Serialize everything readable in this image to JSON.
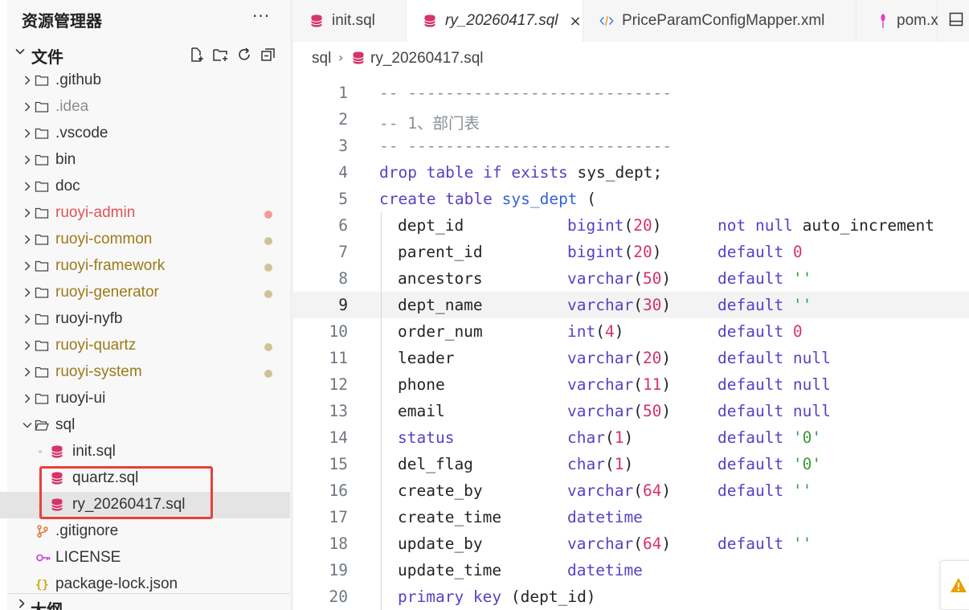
{
  "sidebar": {
    "title": "资源管理器",
    "more": "···",
    "files_section": {
      "title": "文件"
    },
    "outline_section": {
      "title": "大纲"
    },
    "tree": [
      {
        "label": ".github",
        "type": "folder",
        "depth": 0,
        "color": "#333333",
        "status": ""
      },
      {
        "label": ".idea",
        "type": "folder",
        "depth": 0,
        "color": "#8c8c8c",
        "status": ""
      },
      {
        "label": ".vscode",
        "type": "folder",
        "depth": 0,
        "color": "#333333",
        "status": ""
      },
      {
        "label": "bin",
        "type": "folder",
        "depth": 0,
        "color": "#333333",
        "status": ""
      },
      {
        "label": "doc",
        "type": "folder",
        "depth": 0,
        "color": "#333333",
        "status": ""
      },
      {
        "label": "ruoyi-admin",
        "type": "folder",
        "depth": 0,
        "color": "#e05252",
        "status": "error"
      },
      {
        "label": "ruoyi-common",
        "type": "folder",
        "depth": 0,
        "color": "#9c7a1a",
        "status": "modified"
      },
      {
        "label": "ruoyi-framework",
        "type": "folder",
        "depth": 0,
        "color": "#9c7a1a",
        "status": "modified"
      },
      {
        "label": "ruoyi-generator",
        "type": "folder",
        "depth": 0,
        "color": "#9c7a1a",
        "status": "modified"
      },
      {
        "label": "ruoyi-nyfb",
        "type": "folder",
        "depth": 0,
        "color": "#333333",
        "status": ""
      },
      {
        "label": "ruoyi-quartz",
        "type": "folder",
        "depth": 0,
        "color": "#9c7a1a",
        "status": "modified"
      },
      {
        "label": "ruoyi-system",
        "type": "folder",
        "depth": 0,
        "color": "#9c7a1a",
        "status": "modified"
      },
      {
        "label": "ruoyi-ui",
        "type": "folder",
        "depth": 0,
        "color": "#333333",
        "status": ""
      },
      {
        "label": "sql",
        "type": "folder-open",
        "depth": 0,
        "color": "#333333",
        "status": ""
      },
      {
        "label": "init.sql",
        "type": "sql",
        "depth": 1,
        "color": "#333333",
        "status": ""
      },
      {
        "label": "quartz.sql",
        "type": "sql",
        "depth": 1,
        "color": "#333333",
        "status": ""
      },
      {
        "label": "ry_20260417.sql",
        "type": "sql",
        "depth": 1,
        "color": "#333333",
        "status": "",
        "selected": true
      },
      {
        "label": ".gitignore",
        "type": "git",
        "depth": 0,
        "color": "#333333",
        "status": ""
      },
      {
        "label": "LICENSE",
        "type": "license",
        "depth": 0,
        "color": "#333333",
        "status": ""
      },
      {
        "label": "package-lock.json",
        "type": "json",
        "depth": 0,
        "color": "#333333",
        "status": ""
      }
    ]
  },
  "colors": {
    "status_error": "#f29b9b",
    "status_modified": "#cfc29a",
    "sql_icon": "#d6336c",
    "highlight_box": "#e8403c"
  },
  "tabs": [
    {
      "label": "init.sql",
      "icon": "database-icon",
      "active": false
    },
    {
      "label": "ry_20260417.sql",
      "icon": "database-icon",
      "active": true,
      "close": "×"
    },
    {
      "label": "PriceParamConfigMapper.xml",
      "icon": "code-icon",
      "active": false
    },
    {
      "label": "pom.x",
      "icon": "maven-icon",
      "active": false
    }
  ],
  "breadcrumb": {
    "folder": "sql",
    "separator": "›",
    "file": "ry_20260417.sql"
  },
  "editor": {
    "current_line": 9,
    "lines": [
      {
        "n": "1",
        "indent": false,
        "tokens": [
          [
            "comment",
            "-- ----------------------------"
          ]
        ]
      },
      {
        "n": "2",
        "indent": false,
        "tokens": [
          [
            "comment",
            "-- 1、部门表"
          ]
        ]
      },
      {
        "n": "3",
        "indent": false,
        "tokens": [
          [
            "comment",
            "-- ----------------------------"
          ]
        ]
      },
      {
        "n": "4",
        "indent": false,
        "tokens": [
          [
            "kw",
            "drop table if exists "
          ],
          [
            "id",
            "sys_dept;"
          ]
        ]
      },
      {
        "n": "5",
        "indent": false,
        "tokens": [
          [
            "kw",
            "create table "
          ],
          [
            "fn",
            "sys_dept"
          ],
          [
            "id",
            " ("
          ]
        ]
      },
      {
        "n": "6",
        "indent": true,
        "tokens": [
          [
            "id",
            "dept_id"
          ],
          [
            "kw",
            "bigint"
          ],
          [
            "id",
            "("
          ],
          [
            "num",
            "20"
          ],
          [
            "id",
            ")"
          ],
          [
            "kw",
            "not null "
          ],
          [
            "id",
            "auto_increment"
          ]
        ]
      },
      {
        "n": "7",
        "indent": true,
        "tokens": [
          [
            "id",
            "parent_id"
          ],
          [
            "kw",
            "bigint"
          ],
          [
            "id",
            "("
          ],
          [
            "num",
            "20"
          ],
          [
            "id",
            ")"
          ],
          [
            "kw",
            "default "
          ],
          [
            "num",
            "0"
          ]
        ]
      },
      {
        "n": "8",
        "indent": true,
        "tokens": [
          [
            "id",
            "ancestors"
          ],
          [
            "kw",
            "varchar"
          ],
          [
            "id",
            "("
          ],
          [
            "num",
            "50"
          ],
          [
            "id",
            ")"
          ],
          [
            "kw",
            "default "
          ],
          [
            "str",
            "''"
          ]
        ]
      },
      {
        "n": "9",
        "indent": true,
        "tokens": [
          [
            "id",
            "dept_name"
          ],
          [
            "kw",
            "varchar"
          ],
          [
            "id",
            "("
          ],
          [
            "num",
            "30"
          ],
          [
            "id",
            ")"
          ],
          [
            "kw",
            "default "
          ],
          [
            "str",
            "''"
          ]
        ]
      },
      {
        "n": "10",
        "indent": true,
        "tokens": [
          [
            "id",
            "order_num"
          ],
          [
            "kw",
            "int"
          ],
          [
            "id",
            "("
          ],
          [
            "num",
            "4"
          ],
          [
            "id",
            ")"
          ],
          [
            "kw",
            "default "
          ],
          [
            "num",
            "0"
          ]
        ]
      },
      {
        "n": "11",
        "indent": true,
        "tokens": [
          [
            "id",
            "leader"
          ],
          [
            "kw",
            "varchar"
          ],
          [
            "id",
            "("
          ],
          [
            "num",
            "20"
          ],
          [
            "id",
            ")"
          ],
          [
            "kw",
            "default "
          ],
          [
            "kw",
            "null"
          ]
        ]
      },
      {
        "n": "12",
        "indent": true,
        "tokens": [
          [
            "id",
            "phone"
          ],
          [
            "kw",
            "varchar"
          ],
          [
            "id",
            "("
          ],
          [
            "num",
            "11"
          ],
          [
            "id",
            ")"
          ],
          [
            "kw",
            "default "
          ],
          [
            "kw",
            "null"
          ]
        ]
      },
      {
        "n": "13",
        "indent": true,
        "tokens": [
          [
            "id",
            "email"
          ],
          [
            "kw",
            "varchar"
          ],
          [
            "id",
            "("
          ],
          [
            "num",
            "50"
          ],
          [
            "id",
            ")"
          ],
          [
            "kw",
            "default "
          ],
          [
            "kw",
            "null"
          ]
        ]
      },
      {
        "n": "14",
        "indent": true,
        "tokens": [
          [
            "kw",
            "status"
          ],
          [
            "kw",
            "char"
          ],
          [
            "id",
            "("
          ],
          [
            "num",
            "1"
          ],
          [
            "id",
            ")"
          ],
          [
            "kw",
            "default "
          ],
          [
            "str",
            "'0'"
          ]
        ]
      },
      {
        "n": "15",
        "indent": true,
        "tokens": [
          [
            "id",
            "del_flag"
          ],
          [
            "kw",
            "char"
          ],
          [
            "id",
            "("
          ],
          [
            "num",
            "1"
          ],
          [
            "id",
            ")"
          ],
          [
            "kw",
            "default "
          ],
          [
            "str",
            "'0'"
          ]
        ]
      },
      {
        "n": "16",
        "indent": true,
        "tokens": [
          [
            "id",
            "create_by"
          ],
          [
            "kw",
            "varchar"
          ],
          [
            "id",
            "("
          ],
          [
            "num",
            "64"
          ],
          [
            "id",
            ")"
          ],
          [
            "kw",
            "default "
          ],
          [
            "str",
            "''"
          ]
        ]
      },
      {
        "n": "17",
        "indent": true,
        "tokens": [
          [
            "id",
            "create_time"
          ],
          [
            "kw",
            "datetime"
          ]
        ]
      },
      {
        "n": "18",
        "indent": true,
        "tokens": [
          [
            "id",
            "update_by"
          ],
          [
            "kw",
            "varchar"
          ],
          [
            "id",
            "("
          ],
          [
            "num",
            "64"
          ],
          [
            "id",
            ")"
          ],
          [
            "kw",
            "default "
          ],
          [
            "str",
            "''"
          ]
        ]
      },
      {
        "n": "19",
        "indent": true,
        "tokens": [
          [
            "id",
            "update_time"
          ],
          [
            "kw",
            "datetime"
          ]
        ]
      },
      {
        "n": "20",
        "indent": true,
        "tokens": [
          [
            "kw",
            "primary key "
          ],
          [
            "id",
            "(dept_id)"
          ]
        ]
      }
    ]
  },
  "icons": {
    "new_file": "new-file-icon",
    "new_folder": "new-folder-icon",
    "refresh": "refresh-icon",
    "collapse": "collapse-all-icon",
    "layout": "toggle-panel-icon",
    "warning": "warning-icon"
  }
}
